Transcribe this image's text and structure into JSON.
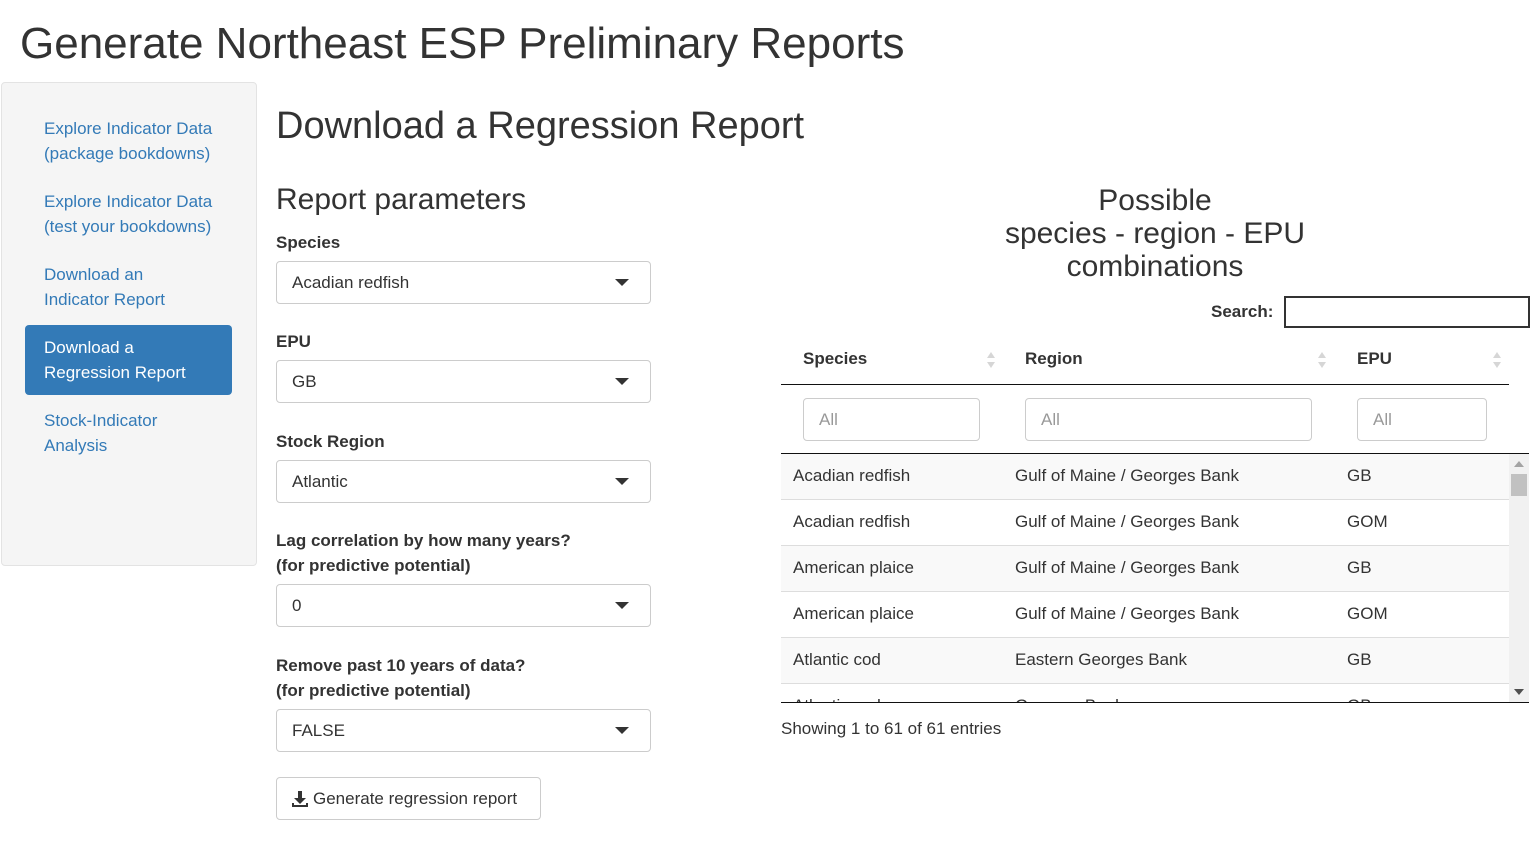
{
  "app": {
    "title": "Generate Northeast ESP Preliminary Reports"
  },
  "sidebar": {
    "items": [
      {
        "label": "Explore Indicator Data (package bookdowns)",
        "active": false
      },
      {
        "label": "Explore Indicator Data (test your bookdowns)",
        "active": false
      },
      {
        "label": "Download an Indicator Report",
        "active": false
      },
      {
        "label": "Download a Regression Report",
        "active": true
      },
      {
        "label": "Stock-Indicator Analysis",
        "active": false
      }
    ]
  },
  "main": {
    "title": "Download a Regression Report",
    "params_title": "Report parameters",
    "species": {
      "label": "Species",
      "value": "Acadian redfish"
    },
    "epu": {
      "label": "EPU",
      "value": "GB"
    },
    "stock_region": {
      "label": "Stock Region",
      "value": "Atlantic"
    },
    "lag": {
      "label_line1": "Lag correlation by how many years?",
      "label_line2": "(for predictive potential)",
      "value": "0"
    },
    "remove": {
      "label_line1": "Remove past 10 years of data?",
      "label_line2": "(for predictive potential)",
      "value": "FALSE"
    },
    "generate_button": "Generate regression report"
  },
  "combos": {
    "title_line1": "Possible",
    "title_line2": "species - region - EPU",
    "title_line3": "combinations",
    "search_label": "Search:",
    "search_value": "",
    "columns": [
      "Species",
      "Region",
      "EPU"
    ],
    "filter_placeholders": [
      "All",
      "All",
      "All"
    ],
    "rows": [
      [
        "Acadian redfish",
        "Gulf of Maine / Georges Bank",
        "GB"
      ],
      [
        "Acadian redfish",
        "Gulf of Maine / Georges Bank",
        "GOM"
      ],
      [
        "American plaice",
        "Gulf of Maine / Georges Bank",
        "GB"
      ],
      [
        "American plaice",
        "Gulf of Maine / Georges Bank",
        "GOM"
      ],
      [
        "Atlantic cod",
        "Eastern Georges Bank",
        "GB"
      ],
      [
        "Atlantic cod",
        "Georges Bank",
        "GB"
      ]
    ],
    "info": "Showing 1 to 61 of 61 entries"
  },
  "colors": {
    "accent": "#337ab7",
    "sidebar_bg": "#f5f5f5"
  },
  "icons": {
    "dropdown": "caret-down-icon",
    "download": "download-icon",
    "sort": "sort-icon"
  }
}
